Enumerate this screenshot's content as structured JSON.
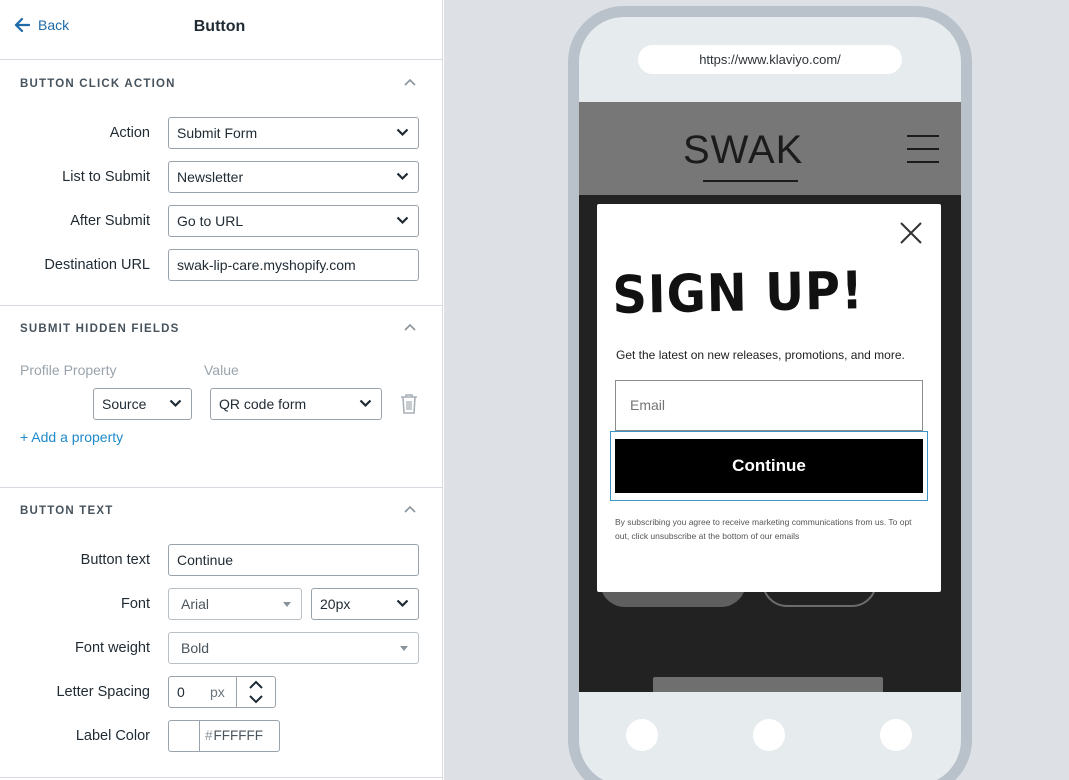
{
  "header": {
    "back_label": "Back",
    "title": "Button"
  },
  "click_action": {
    "section_title": "BUTTON CLICK ACTION",
    "action_label": "Action",
    "action_value": "Submit Form",
    "list_label": "List to Submit",
    "list_value": "Newsletter",
    "after_label": "After Submit",
    "after_value": "Go to URL",
    "dest_label": "Destination URL",
    "dest_value": "swak-lip-care.myshopify.com"
  },
  "hidden_fields": {
    "section_title": "SUBMIT HIDDEN FIELDS",
    "col_property": "Profile Property",
    "col_value": "Value",
    "property_value": "Source",
    "value_value": "QR code form",
    "add_label": "+ Add a property"
  },
  "button_text": {
    "section_title": "BUTTON TEXT",
    "text_label": "Button text",
    "text_value": "Continue",
    "font_label": "Font",
    "font_value": "Arial",
    "size_value": "20px",
    "weight_label": "Font weight",
    "weight_value": "Bold",
    "spacing_label": "Letter Spacing",
    "spacing_value": "0",
    "spacing_unit": "px",
    "color_label": "Label Color",
    "color_hash": "#",
    "color_value": "FFFFFF"
  },
  "preview": {
    "url": "https://www.klaviyo.com/",
    "logo": "SWAK",
    "modal": {
      "heading": "SIGN UP!",
      "tagline": "Get the latest on new releases, promotions, and more.",
      "email_placeholder": "Email",
      "cta": "Continue",
      "disclaimer": "By subscribing you agree to receive marketing communications from us. To opt out, click unsubscribe at the bottom of our emails"
    }
  },
  "colors": {
    "accent": "#1f6aa8",
    "link": "#1f8ac9",
    "cta_bg": "#000000",
    "focus": "#3c94c9"
  }
}
